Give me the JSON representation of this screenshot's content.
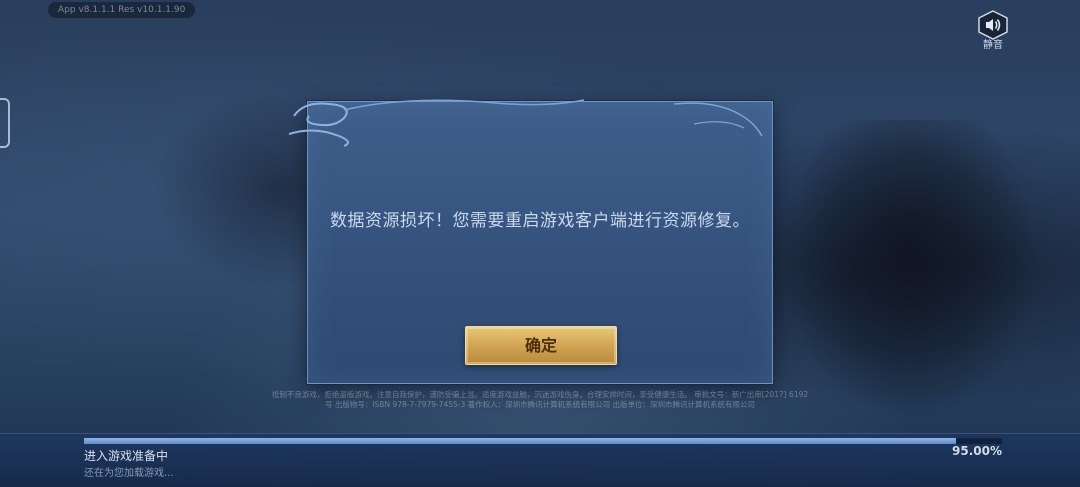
{
  "version": "App v8.1.1.1   Res v10.1.1.90",
  "sound": {
    "label": "静音",
    "icon": "speaker-icon"
  },
  "dialog": {
    "message": "数据资源损坏！您需要重启游戏客户端进行资源修复。",
    "confirm_label": "确定"
  },
  "legal_text": "抵制不良游戏，拒绝盗版游戏。注意自我保护，谨防受骗上当。适度游戏益脑，沉迷游戏伤身。合理安排时间，享受健康生活。 审批文号：新广出审[2017] 6192号  出版物号：ISBN 978-7-7979-7455-3  著作权人：深圳市腾讯计算机系统有限公司  出版单位：深圳市腾讯计算机系统有限公司",
  "loading": {
    "title": "进入游戏准备中",
    "subtitle": "还在为您加载游戏...",
    "percent_label": "95.00%",
    "progress": 0.95
  },
  "colors": {
    "dialog_bg": "#34527c",
    "dialog_border": "#6f93c2",
    "button_gold": "#d3a957",
    "progress_fill": "#7aa3d9"
  }
}
